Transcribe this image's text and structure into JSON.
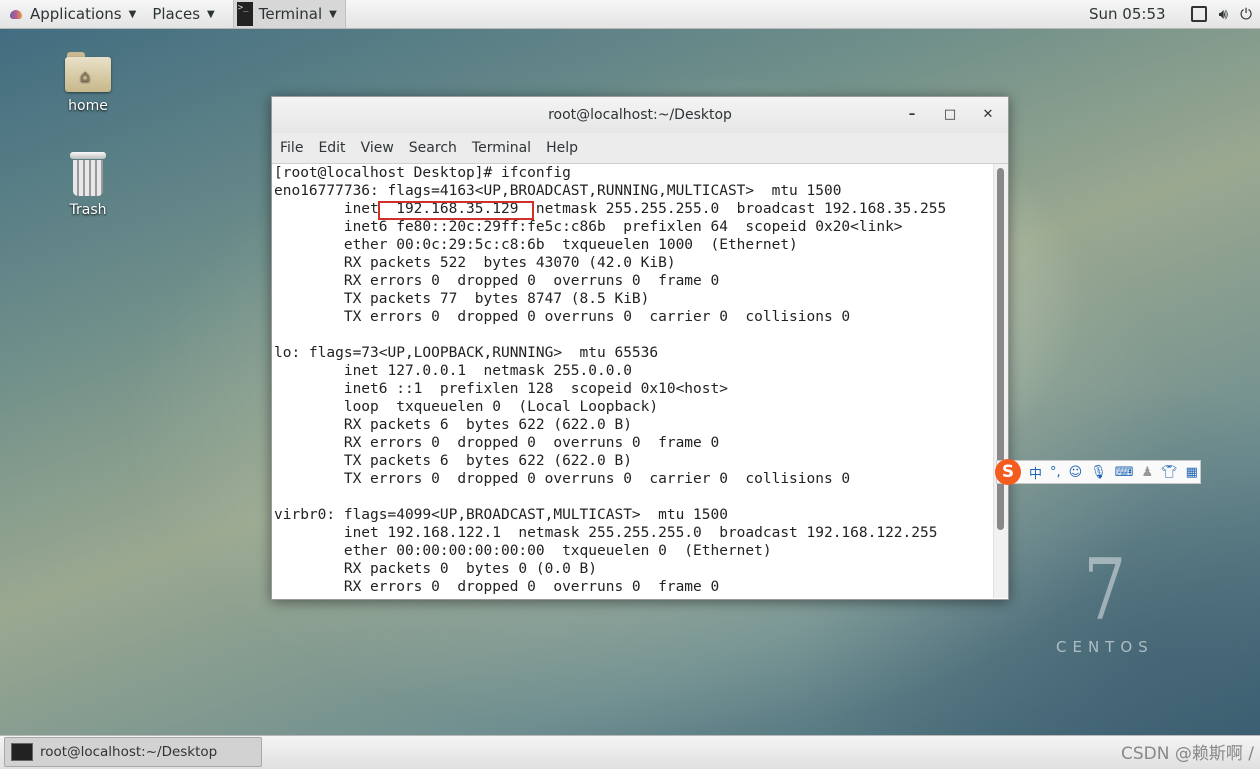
{
  "top_panel": {
    "applications": "Applications",
    "places": "Places",
    "terminal": "Terminal",
    "clock": "Sun 05:53"
  },
  "desktop_icons": {
    "home": "home",
    "trash": "Trash"
  },
  "window": {
    "title": "root@localhost:~/Desktop",
    "minimize": "–",
    "maximize": "□",
    "close": "✕",
    "menu": [
      "File",
      "Edit",
      "View",
      "Search",
      "Terminal",
      "Help"
    ]
  },
  "terminal_lines": [
    "[root@localhost Desktop]# ifconfig",
    "eno16777736: flags=4163<UP,BROADCAST,RUNNING,MULTICAST>  mtu 1500",
    "        inet  192.168.35.129  netmask 255.255.255.0  broadcast 192.168.35.255",
    "        inet6 fe80::20c:29ff:fe5c:c86b  prefixlen 64  scopeid 0x20<link>",
    "        ether 00:0c:29:5c:c8:6b  txqueuelen 1000  (Ethernet)",
    "        RX packets 522  bytes 43070 (42.0 KiB)",
    "        RX errors 0  dropped 0  overruns 0  frame 0",
    "        TX packets 77  bytes 8747 (8.5 KiB)",
    "        TX errors 0  dropped 0 overruns 0  carrier 0  collisions 0",
    "",
    "lo: flags=73<UP,LOOPBACK,RUNNING>  mtu 65536",
    "        inet 127.0.0.1  netmask 255.0.0.0",
    "        inet6 ::1  prefixlen 128  scopeid 0x10<host>",
    "        loop  txqueuelen 0  (Local Loopback)",
    "        RX packets 6  bytes 622 (622.0 B)",
    "        RX errors 0  dropped 0  overruns 0  frame 0",
    "        TX packets 6  bytes 622 (622.0 B)",
    "        TX errors 0  dropped 0 overruns 0  carrier 0  collisions 0",
    "",
    "virbr0: flags=4099<UP,BROADCAST,MULTICAST>  mtu 1500",
    "        inet 192.168.122.1  netmask 255.255.255.0  broadcast 192.168.122.255",
    "        ether 00:00:00:00:00:00  txqueuelen 0  (Ethernet)",
    "        RX packets 0  bytes 0 (0.0 B)",
    "        RX errors 0  dropped 0  overruns 0  frame 0"
  ],
  "ime_bar": {
    "logo": "S",
    "chinese": "中",
    "punct": "°,"
  },
  "wallpaper": {
    "version": "7",
    "brand": "CENTOS"
  },
  "taskbar": {
    "window_label": "root@localhost:~/Desktop"
  },
  "watermark": "CSDN @赖斯啊 /",
  "colors": {
    "highlight_box": "#d0302a",
    "ime_logo": "#f25c1e"
  }
}
